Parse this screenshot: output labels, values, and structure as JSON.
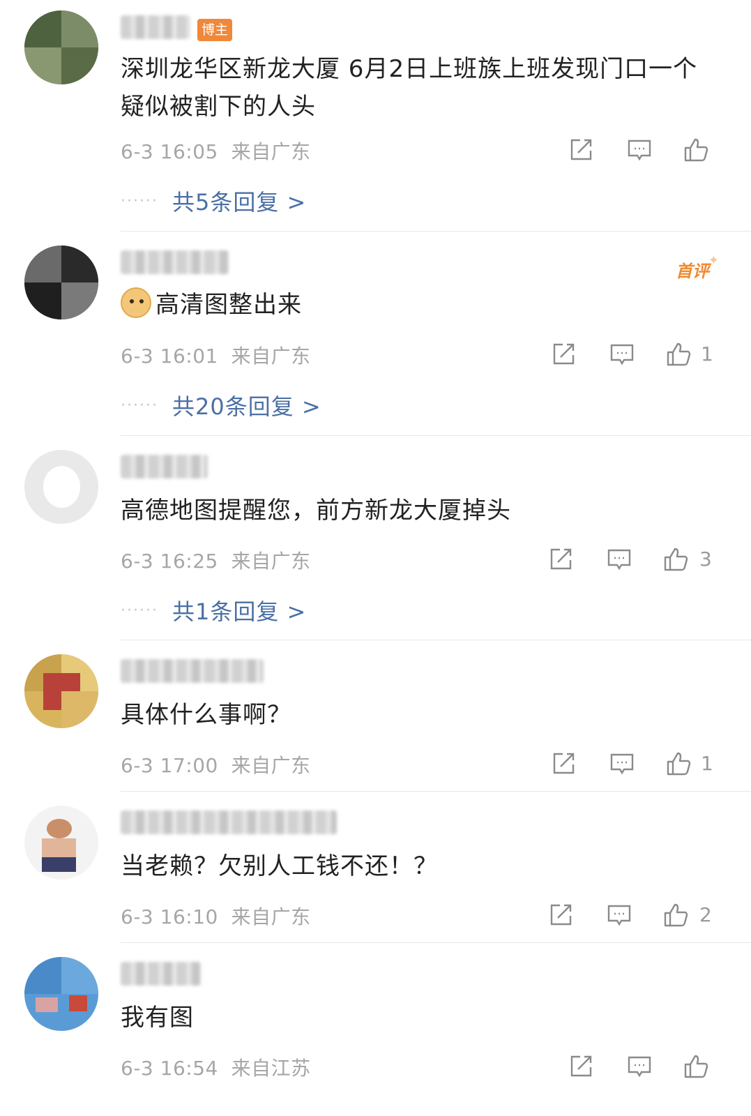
{
  "comments": [
    {
      "badge": "博主",
      "text": "深圳龙华区新龙大厦 6月2日上班族上班发现门口一个疑似被割下的人头",
      "time": "6-3 16:05",
      "location": "来自广东",
      "likes": "",
      "replies": "共5条回复 >"
    },
    {
      "badge": "首评",
      "text": "高清图整出来",
      "time": "6-3 16:01",
      "location": "来自广东",
      "likes": "1",
      "replies": "共20条回复 >"
    },
    {
      "badge": "",
      "text": "高德地图提醒您，前方新龙大厦掉头",
      "time": "6-3 16:25",
      "location": "来自广东",
      "likes": "3",
      "replies": "共1条回复 >"
    },
    {
      "badge": "",
      "text": "具体什么事啊？",
      "time": "6-3 17:00",
      "location": "来自广东",
      "likes": "1",
      "replies": ""
    },
    {
      "badge": "",
      "text": "当老赖？欠别人工钱不还！？",
      "time": "6-3 16:10",
      "location": "来自广东",
      "likes": "2",
      "replies": ""
    },
    {
      "badge": "",
      "text": "我有图",
      "time": "6-3 16:54",
      "location": "来自江苏",
      "likes": "",
      "replies": ""
    }
  ],
  "reply_dots": "······",
  "icons": {
    "share": "share-icon",
    "comment": "comment-icon",
    "like": "thumbs-up-icon",
    "emoji": "doge-emoji-icon"
  },
  "colors": {
    "link": "#4a6fa5",
    "meta": "#a6a6a6",
    "blogger_badge": "#f0883a",
    "first_badge": "#f08a2f"
  }
}
